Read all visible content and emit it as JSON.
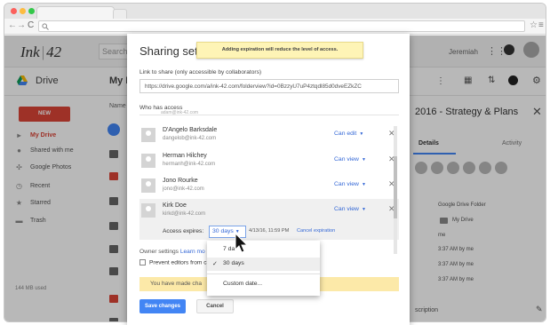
{
  "browser": {
    "dots": [
      "#fc605c",
      "#fdbc40",
      "#34c84a"
    ],
    "nav": {
      "back": "←",
      "forward": "→",
      "reload": "C"
    },
    "omnibox_icon": "search-icon",
    "right_icons": [
      "star-icon",
      "menu-icon"
    ]
  },
  "drive": {
    "logo_left": "Ink",
    "logo_sep": "|",
    "logo_right": "42",
    "search_placeholder": "Search",
    "user": "Jeremiah",
    "app_title": "Drive",
    "subheader_title": "My Dr",
    "column_header": "Name",
    "new_label": "NEW",
    "sidebar": [
      {
        "label": "My Drive",
        "icon": "folder-icon",
        "active": true
      },
      {
        "label": "Shared with me",
        "icon": "people-icon",
        "active": false
      },
      {
        "label": "Google Photos",
        "icon": "pinwheel-icon",
        "active": false
      },
      {
        "label": "Recent",
        "icon": "clock-icon",
        "active": false
      },
      {
        "label": "Starred",
        "icon": "star-icon",
        "active": false
      },
      {
        "label": "Trash",
        "icon": "trash-icon",
        "active": false
      }
    ],
    "storage": "144 MB used",
    "details_panel": {
      "title": "2016 - Strategy & Plans",
      "tabs": [
        "Details",
        "Activity"
      ],
      "type": "Google Drive Folder",
      "location": "My Drive",
      "owner": "me",
      "modified": "3:37 AM by me",
      "opened": "3:37 AM by me",
      "created": "3:37 AM by me",
      "description_label": "scription"
    }
  },
  "dialog": {
    "title": "Sharing setti",
    "tooltip": "Adding expiration will reduce the level of access.",
    "link_label": "Link to share (only accessible by collaborators)",
    "link_url": "https://drive.google.com/a/ink-42.com/folderview?id=0BzzyU7uP4ztqdl85d0dveEZkZC",
    "who_label": "Who has access",
    "partial_email": "adam@ink-42.com",
    "people": [
      {
        "name": "D'Angelo Barksdale",
        "email": "dangelob@ink-42.com",
        "role": "Can edit"
      },
      {
        "name": "Herman Hilchey",
        "email": "hermanh@ink-42.com",
        "role": "Can view"
      },
      {
        "name": "Jono Rourke",
        "email": "jono@ink-42.com",
        "role": "Can view"
      },
      {
        "name": "Kirk Doe",
        "email": "kirkd@ink-42.com",
        "role": "Can view"
      }
    ],
    "remove_glyph": "✕",
    "role_caret": "▼",
    "expires_label": "Access expires:",
    "expires_value": "30 days",
    "expires_date": "4/13/16, 11:59 PM",
    "cancel_expiration": "Cancel expiration",
    "owner_settings": "Owner settings",
    "learn_more": "Learn mo",
    "prevent_editors": "Prevent editors from c",
    "warning": "You have made cha",
    "save_label": "Save changes",
    "cancel_label": "Cancel"
  },
  "menu": {
    "items": [
      {
        "label": "7 da",
        "selected": false,
        "checked": false
      },
      {
        "label": "30 days",
        "selected": true,
        "checked": true
      },
      {
        "label": "Custom date...",
        "selected": false,
        "checked": false
      }
    ],
    "check_glyph": "✓"
  }
}
